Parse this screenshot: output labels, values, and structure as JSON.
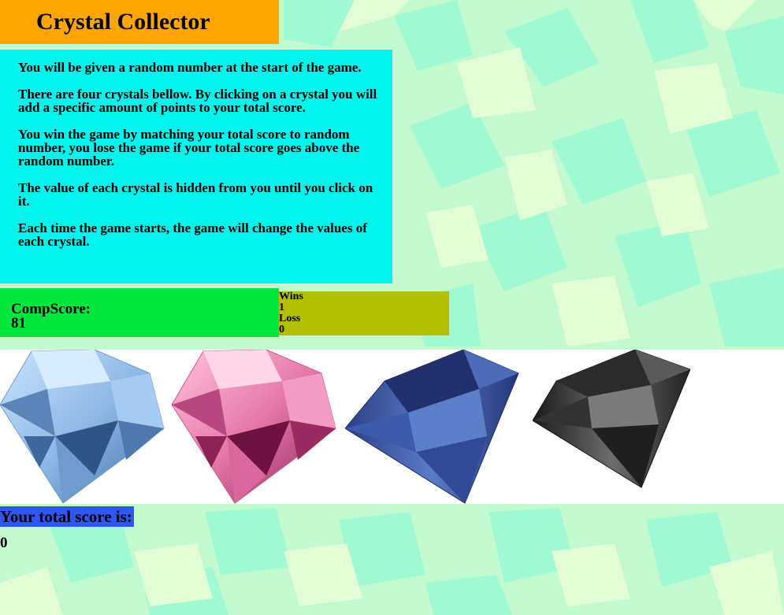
{
  "header": {
    "title": "Crystal Collector"
  },
  "instructions": [
    "You will be given a random number at the start of the game.",
    "There are four crystals bellow. By clicking on a crystal you will add a specific amount of points to your total score.",
    "You win the game by matching your total score to random number, you lose the game if your total score goes above the random number.",
    "The value of each crystal is hidden from you until you click on it.",
    "Each time the game starts, the game will change the values of each crystal."
  ],
  "computer": {
    "label": "CompScore:",
    "value": "81"
  },
  "stats": {
    "wins_label": "Wins",
    "wins": "1",
    "loss_label": "Loss",
    "losses": "0"
  },
  "crystals": [
    {
      "name": "light-blue-crystal",
      "color": "#9fc9f0"
    },
    {
      "name": "pink-crystal",
      "color": "#ec7fb0"
    },
    {
      "name": "dark-blue-crystal",
      "color": "#3b5aa8"
    },
    {
      "name": "black-crystal",
      "color": "#3a3a3a"
    }
  ],
  "score": {
    "label": "Your total score is:",
    "value": "0"
  },
  "colors": {
    "title_bg": "#ffa500",
    "instructions_bg": "#00f5ed",
    "comp_bg": "#00e63c",
    "stats_bg": "#b1c000",
    "score_label_bg": "#2f57f2",
    "background_mint": "#9ff9d2",
    "background_lime": "#e2fcd5"
  }
}
